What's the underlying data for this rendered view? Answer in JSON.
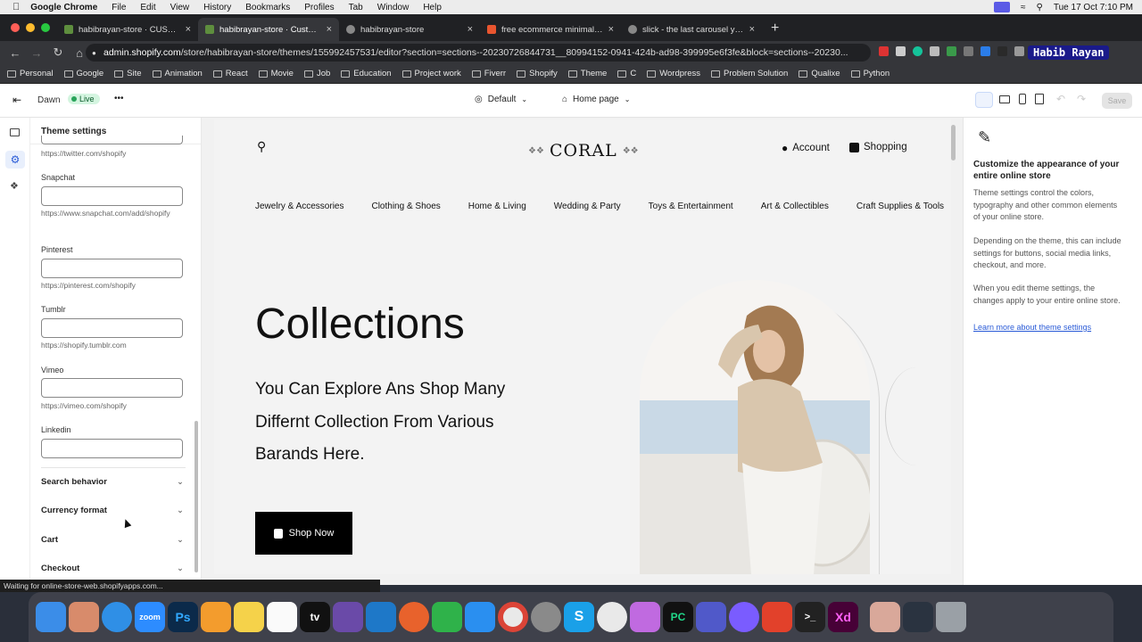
{
  "menubar": {
    "app": "Google Chrome",
    "items": [
      "File",
      "Edit",
      "View",
      "History",
      "Bookmarks",
      "Profiles",
      "Tab",
      "Window",
      "Help"
    ],
    "datetime": "Tue 17 Oct  7:10 PM"
  },
  "tabs": [
    {
      "title": "habibrayan-store · CUSTOMER",
      "fav": "#5e8e3e",
      "active": false
    },
    {
      "title": "habibrayan-store · Customize",
      "fav": "#5e8e3e",
      "active": true
    },
    {
      "title": "habibrayan-store",
      "fav": "#888",
      "active": false
    },
    {
      "title": "free ecommerce minimal temp",
      "fav": "#e9552f",
      "active": false
    },
    {
      "title": "slick - the last carousel you'll",
      "fav": "#888",
      "active": false
    }
  ],
  "url": {
    "host": "admin.shopify.com",
    "path": "/store/habibrayan-store/themes/155992457531/editor?section=sections--20230726844731__80994152-0941-424b-ad98-399995e6f3fe&block=sections--20230..."
  },
  "profile": "Habib Rayan",
  "bookmarks": [
    "Personal",
    "Google",
    "Site",
    "Animation",
    "React",
    "Movie",
    "Job",
    "Education",
    "Project work",
    "Fiverr",
    "Shopify",
    "Theme",
    "C",
    "Wordpress",
    "Problem Solution",
    "Qualixe",
    "Python"
  ],
  "editor": {
    "theme_name": "Dawn",
    "live_badge": "Live",
    "more": "•••",
    "locale": "Default",
    "page": "Home page",
    "save": "Save"
  },
  "sidebar": {
    "title": "Theme settings",
    "twitter_hint": "https://twitter.com/shopify",
    "fields": [
      {
        "label": "Snapchat",
        "hint": "https://www.snapchat.com/add/shopify"
      },
      {
        "label": "Pinterest",
        "hint": "https://pinterest.com/shopify"
      },
      {
        "label": "Tumblr",
        "hint": "https://shopify.tumblr.com"
      },
      {
        "label": "Vimeo",
        "hint": "https://vimeo.com/shopify"
      },
      {
        "label": "Linkedin",
        "hint": ""
      }
    ],
    "accordions": [
      "Search behavior",
      "Currency format",
      "Cart",
      "Checkout"
    ]
  },
  "store": {
    "logo": "CORAL",
    "account": "Account",
    "cart": "Shopping",
    "categories": [
      "Jewelry & Accessories",
      "Clothing & Shoes",
      "Home & Living",
      "Wedding & Party",
      "Toys & Entertainment",
      "Art & Collectibles",
      "Craft Supplies & Tools"
    ],
    "hero_title": "Collections",
    "hero_text_1": "You Can Explore Ans Shop Many",
    "hero_text_2": "Differnt Collection From Various",
    "hero_text_3": "Barands Here.",
    "cta": "Shop Now"
  },
  "right_panel": {
    "heading": "Customize the appearance of your entire online store",
    "p1": "Theme settings control the colors, typography and other common elements of your online store.",
    "p2": "Depending on the theme, this can include settings for buttons, social media links, checkout, and more.",
    "p3": "When you edit theme settings, the changes apply to your entire online store.",
    "link": "Learn more about theme settings"
  },
  "status": "Waiting for online-store-web.shopifyapps.com...",
  "dock": [
    {
      "name": "finder",
      "color": "#3b8de8",
      "label": ""
    },
    {
      "name": "launchpad",
      "color": "#d88b6b",
      "label": ""
    },
    {
      "name": "safari",
      "color": "#2f8fe6",
      "label": ""
    },
    {
      "name": "zoom",
      "color": "#2d8cff",
      "label": "zoom"
    },
    {
      "name": "photoshop",
      "color": "#0b2a4a",
      "label": "Ps"
    },
    {
      "name": "pages",
      "color": "#f39c2d",
      "label": ""
    },
    {
      "name": "notes",
      "color": "#f5d24a",
      "label": ""
    },
    {
      "name": "freeform",
      "color": "#fafafa",
      "label": ""
    },
    {
      "name": "appletv",
      "color": "#111",
      "label": "tv"
    },
    {
      "name": "quill",
      "color": "#6a4aa8",
      "label": ""
    },
    {
      "name": "vscode",
      "color": "#1e78c8",
      "label": ""
    },
    {
      "name": "firefox",
      "color": "#e8622c",
      "label": ""
    },
    {
      "name": "numbers",
      "color": "#2fb24a",
      "label": ""
    },
    {
      "name": "appstore",
      "color": "#2a8ff0",
      "label": ""
    },
    {
      "name": "chrome",
      "color": "#e9e9e9",
      "label": ""
    },
    {
      "name": "settings",
      "color": "#8a8a8a",
      "label": ""
    },
    {
      "name": "skype",
      "color": "#1aa0e8",
      "label": "S"
    },
    {
      "name": "clock",
      "color": "#e9e9e9",
      "label": ""
    },
    {
      "name": "gradient",
      "color": "#c06ae0",
      "label": ""
    },
    {
      "name": "pycharm",
      "color": "#111",
      "label": "PC"
    },
    {
      "name": "teams",
      "color": "#5059c9",
      "label": ""
    },
    {
      "name": "messenger",
      "color": "#7a5cff",
      "label": ""
    },
    {
      "name": "anydesk",
      "color": "#e2412b",
      "label": ""
    },
    {
      "name": "terminal",
      "color": "#222",
      "label": ">_"
    },
    {
      "name": "xd",
      "color": "#470137",
      "label": "Xd"
    },
    {
      "name": "photo",
      "color": "#d9a89a",
      "label": ""
    },
    {
      "name": "screen",
      "color": "#2a3340",
      "label": ""
    },
    {
      "name": "trash",
      "color": "#9aa0a6",
      "label": ""
    }
  ]
}
